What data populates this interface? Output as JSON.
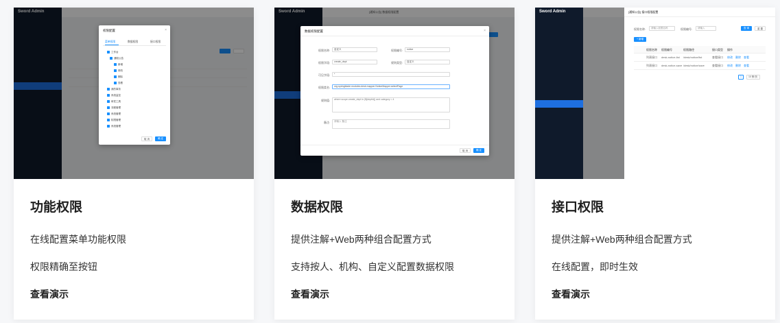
{
  "cards": [
    {
      "title": "功能权限",
      "lines": [
        "在线配置菜单功能权限",
        "权限精确至按钮"
      ],
      "link": "查看演示",
      "shot": {
        "logo": "Sword Admin",
        "modal_title": "权限配置",
        "tabs": [
          "菜单权限",
          "数据权限",
          "接口权限"
        ],
        "tree": [
          "工作台",
          "通知公告",
          "新增",
          "修改",
          "删除",
          "查看",
          "我的事务",
          "系统监控",
          "研发工具",
          "流程管理",
          "系统管理",
          "权限管理",
          "系统管理"
        ],
        "cancel": "取 消",
        "ok": "确 定"
      }
    },
    {
      "title": "数据权限",
      "lines": [
        "提供注解+Web两种组合配置方式",
        "支持按人、机构、自定义配置数据权限"
      ],
      "link": "查看演示",
      "shot": {
        "logo": "Sword Admin",
        "window_title": "[通知公告] 数据权限配置",
        "modal_title": "数据权限配置",
        "fields": {
          "name_label": "权限名称:",
          "name_value": "自定义",
          "code_label": "权限编号:",
          "code_value": "notice",
          "column_label": "权限字段:",
          "column_value": "create_dept",
          "type_label": "规则类型:",
          "type_value": "自定义",
          "visible_label": "可见字段:",
          "visible_value": "*",
          "class_label": "权限类名:",
          "class_value": "org.springblade.modules.desk.mapper.NoticeMapper.selectPage",
          "value_label": "规则值:",
          "value_value": "where scope.create_dept in (${deptId}) and category = 4",
          "remark_label": "备注:",
          "remark_placeholder": "请输入 备注"
        },
        "cancel": "取 消",
        "ok": "确 定"
      }
    },
    {
      "title": "接口权限",
      "lines": [
        "提供注解+Web两种组合配置方式",
        "在线配置，即时生效"
      ],
      "link": "查看演示",
      "shot": {
        "logo": "Sword Admin",
        "window_title": "[通知公告] 接口权限配置",
        "search": {
          "name_label": "权限名称:",
          "name_placeholder": "请输入权限名称",
          "code_label": "权限编号:",
          "code_placeholder": "请输入",
          "search_btn": "查 询",
          "reset_btn": "重 置",
          "add_btn": "+ 新增"
        },
        "columns": [
          "权限名称",
          "权限编号",
          "权限路径",
          "接口类型",
          "操作"
        ],
        "rows": [
          [
            "列表接口",
            "desk-notice-list",
            "/desk/notice/list",
            "查看接口"
          ],
          [
            "列表接口",
            "desk-notice-save",
            "/desk/notice/save",
            "查看接口"
          ]
        ],
        "row_ops": [
          "修改",
          "删除",
          "查看"
        ],
        "pager_size": "10 条/页",
        "pager_page": "1"
      }
    }
  ]
}
